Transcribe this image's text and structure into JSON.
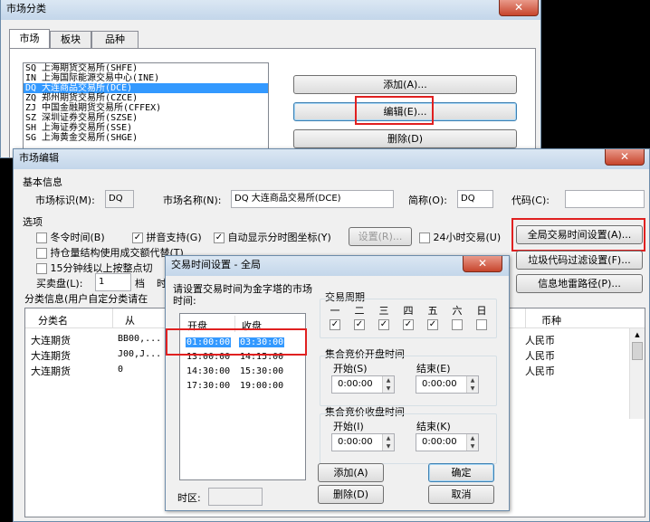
{
  "bg_window": {
    "title": "市场分类",
    "tabs": [
      "市场",
      "板块",
      "品种"
    ],
    "markets": [
      "SQ 上海期货交易所(SHFE)",
      "IN 上海国际能源交易中心(INE)",
      "DQ 大连商品交易所(DCE)",
      "ZQ 郑州期货交易所(CZCE)",
      "ZJ 中国金融期货交易所(CFFEX)",
      "SZ 深圳证券交易所(SZSE)",
      "SH 上海证券交易所(SSE)",
      "SG 上海黄金交易所(SHGE)"
    ],
    "selected_index": 2,
    "buttons": {
      "add": "添加(A)...",
      "edit": "编辑(E)...",
      "delete": "删除(D)"
    }
  },
  "edit_window": {
    "title": "市场编辑",
    "basic_info": "基本信息",
    "market_id_label": "市场标识(M):",
    "market_id_value": "DQ",
    "market_name_label": "市场名称(N):",
    "market_name_value": "DQ 大连商品交易所(DCE)",
    "short_name_label": "简称(O):",
    "short_name_value": "DQ",
    "code_label": "代码(C):",
    "code_value": "",
    "options_label": "选项",
    "opt_winter": "冬令时间(B)",
    "opt_pinyin": "拼音支持(G)",
    "opt_auto": "自动显示分时图坐标(Y)",
    "settings_button": "设置(R)...",
    "opt_24h": "24小时交易(U)",
    "opt_position": "持仓量结构使用成交额代替(T)",
    "opt_15min": "15分钟线以上按整点切",
    "buy_sell_label": "买卖盘(L):",
    "buy_sell_value": "1",
    "buy_sell_unit": "档",
    "buy_sell_suffix": "时",
    "global_time_button": "全局交易时间设置(A)...",
    "junk_filter_button": "垃圾代码过滤设置(F)...",
    "info_mine_button": "信息地雷路径(P)...",
    "category_info": "分类信息(用户自定分类请在",
    "table_headers": [
      "分类名",
      "从",
      "币种"
    ],
    "table_rows": [
      {
        "name": "大连期货",
        "from": "BB00,...",
        "currency": "人民币"
      },
      {
        "name": "大连期货",
        "from": "J00,J...",
        "currency": "人民币"
      },
      {
        "name": "大连期货",
        "from": "0",
        "currency": "人民币"
      }
    ]
  },
  "time_dialog": {
    "title": "交易时间设置 - 全局",
    "instruction": "请设置交易时间为金字塔的市场时间:",
    "col_open": "开盘",
    "col_close": "收盘",
    "sessions": [
      {
        "open": "01:00:00",
        "close": "03:30:00"
      },
      {
        "open": "13:00:00",
        "close": "14:15:00"
      },
      {
        "open": "14:30:00",
        "close": "15:30:00"
      },
      {
        "open": "17:30:00",
        "close": "19:00:00"
      }
    ],
    "timezone_label": "时区:",
    "timezone_value": "",
    "week_label": "交易周期",
    "weekdays": [
      {
        "name": "一",
        "checked": true
      },
      {
        "name": "二",
        "checked": true
      },
      {
        "name": "三",
        "checked": true
      },
      {
        "name": "四",
        "checked": true
      },
      {
        "name": "五",
        "checked": true
      },
      {
        "name": "六",
        "checked": false
      },
      {
        "name": "日",
        "checked": false
      }
    ],
    "open_auction_label": "集合竞价开盘时间",
    "close_auction_label": "集合竞价收盘时间",
    "start_s_label": "开始(S)",
    "end_e_label": "结束(E)",
    "start_i_label": "开始(I)",
    "end_k_label": "结束(K)",
    "open_start": "0:00:00",
    "open_end": "0:00:00",
    "close_start": "0:00:00",
    "close_end": "0:00:00",
    "add_button": "添加(A)",
    "delete_button": "删除(D)",
    "ok_button": "确定",
    "cancel_button": "取消"
  },
  "colors": {
    "highlight": "#e02020",
    "selection": "#3399ff"
  }
}
